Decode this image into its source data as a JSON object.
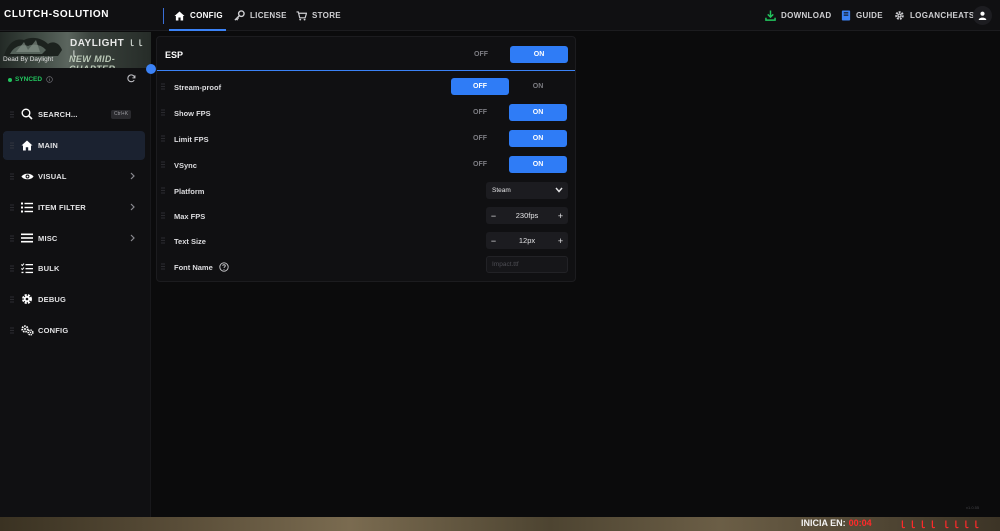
{
  "app": {
    "brand": "CLUTCH-SOLUTION"
  },
  "topnav": {
    "left": [
      {
        "label": "CONFIG",
        "icon": "home-icon",
        "active": true
      },
      {
        "label": "LICENSE",
        "icon": "key-icon",
        "active": false
      },
      {
        "label": "STORE",
        "icon": "cart-icon",
        "active": false
      }
    ],
    "right": [
      {
        "label": "DOWNLOAD",
        "icon": "download-icon"
      },
      {
        "label": "GUIDE",
        "icon": "book-icon"
      },
      {
        "label": "LOGANCHEATS",
        "icon": "gear-icon"
      }
    ]
  },
  "sidebar": {
    "banner": {
      "title": "DAYLIGHT",
      "title_mark": "ｌｌｌ",
      "subtitle": "Dead By Daylight",
      "chapter": "NEW MID-CHAPTER"
    },
    "status": "SYNCED",
    "search": {
      "label": "SEARCH...",
      "shortcut": "Ctrl+K"
    },
    "items": [
      {
        "label": "MAIN",
        "icon": "home-icon",
        "active": true,
        "has_chevron": false
      },
      {
        "label": "VISUAL",
        "icon": "eye-icon",
        "active": false,
        "has_chevron": true
      },
      {
        "label": "ITEM FILTER",
        "icon": "list-icon",
        "active": false,
        "has_chevron": true
      },
      {
        "label": "MISC",
        "icon": "menu-icon",
        "active": false,
        "has_chevron": true
      },
      {
        "label": "BULK",
        "icon": "checklist-icon",
        "active": false,
        "has_chevron": false
      },
      {
        "label": "DEBUG",
        "icon": "gear-icon",
        "active": false,
        "has_chevron": false
      },
      {
        "label": "CONFIG",
        "icon": "cogs-icon",
        "active": false,
        "has_chevron": false
      }
    ]
  },
  "panel": {
    "title": "ESP",
    "master_toggle": {
      "off": "OFF",
      "on": "ON",
      "value": "on"
    },
    "rows": [
      {
        "label": "Stream-proof",
        "type": "toggle",
        "off": "OFF",
        "on": "ON",
        "value": "off"
      },
      {
        "label": "Show FPS",
        "type": "toggle",
        "off": "OFF",
        "on": "ON",
        "value": "on"
      },
      {
        "label": "Limit FPS",
        "type": "toggle",
        "off": "OFF",
        "on": "ON",
        "value": "on"
      },
      {
        "label": "VSync",
        "type": "toggle",
        "off": "OFF",
        "on": "ON",
        "value": "on"
      },
      {
        "label": "Platform",
        "type": "select",
        "value": "Steam"
      },
      {
        "label": "Max FPS",
        "type": "stepper",
        "value": "230fps",
        "minus": "−",
        "plus": "+"
      },
      {
        "label": "Text Size",
        "type": "stepper",
        "value": "12px",
        "minus": "−",
        "plus": "+"
      },
      {
        "label": "Font Name",
        "type": "text",
        "placeholder": "Impact.ttf",
        "value": ""
      }
    ]
  },
  "corner_text": "v1.0.55",
  "footer": {
    "label": "INICIA EN:",
    "time": "00:04",
    "marks": "ｌｌｌｌ ｌｌｌｌ"
  },
  "colors": {
    "accent": "#2f7cf6",
    "synced": "#22c55e",
    "timer": "#ff2a2a"
  }
}
